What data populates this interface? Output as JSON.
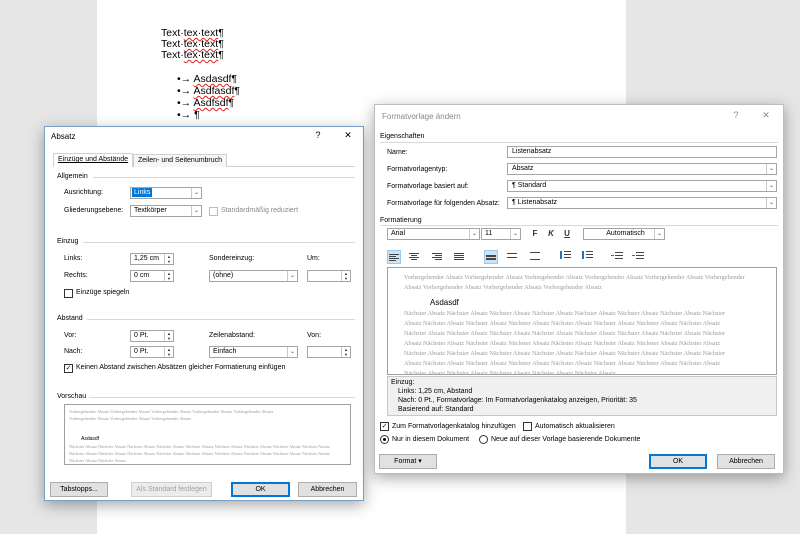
{
  "document": {
    "lines": [
      "Text·tex·text¶",
      "Text·tex·text¶",
      "Text·tex·text¶"
    ],
    "bullets": [
      "•→ Asdasdf¶",
      "•→ Asdfasdf¶",
      "•→ Asdfsdf¶",
      "•→ ¶"
    ]
  },
  "absatz": {
    "title": "Absatz",
    "help": "?",
    "close": "✕",
    "tabs": [
      "Einzüge und Abstände",
      "Zeilen- und Seitenumbruch"
    ],
    "allgemein": {
      "header": "Allgemein",
      "ausrichtung_label": "Ausrichtung:",
      "ausrichtung_value": "Links",
      "gliederung_label": "Gliederungsebene:",
      "gliederung_value": "Textkörper",
      "standard_reduziert": "Standardmäßig reduziert"
    },
    "einzug": {
      "header": "Einzug",
      "links_label": "Links:",
      "links_value": "1,25 cm",
      "rechts_label": "Rechts:",
      "rechts_value": "0 cm",
      "sondereinzug_label": "Sondereinzug:",
      "sondereinzug_value": "(ohne)",
      "um_label": "Um:",
      "spiegeln_label": "Einzüge spiegeln"
    },
    "abstand": {
      "header": "Abstand",
      "vor_label": "Vor:",
      "vor_value": "0 Pt.",
      "nach_label": "Nach:",
      "nach_value": "0 Pt.",
      "zeilenabstand_label": "Zeilenabstand:",
      "zeilenabstand_value": "Einfach",
      "von_label": "Von:",
      "kein_abstand_label": "Keinen Abstand zwischen Absätzen gleicher Formatierung einfügen"
    },
    "vorschau": {
      "header": "Vorschau",
      "prev": "Vorhergehender Absatz Vorhergehender Absatz Vorhergehender Absatz Vorhergehender Absatz Vorhergehender Absatz Vorhergehender Absatz Vorhergehender Absatz Vorhergehender Absatz",
      "sample": "Asdasdf",
      "next": "Nächster Absatz Nächster Absatz Nächster Absatz Nächster Absatz Nächster Absatz Nächster Absatz Nächster Absatz Nächster Absatz Nächster Absatz Nächster Absatz Nächster Absatz Nächster Absatz Nächster Absatz Nächster Absatz Nächster Absatz Nächster Absatz Nächster Absatz Nächster Absatz Nächster Absatz Nächster Absatz"
    },
    "buttons": {
      "tabstopps": "Tabstopps...",
      "als_standard": "Als Standard festlegen",
      "ok": "OK",
      "abbrechen": "Abbrechen"
    }
  },
  "formatvorlage": {
    "title": "Formatvorlage ändern",
    "help": "?",
    "close": "✕",
    "eigenschaften": {
      "header": "Eigenschaften",
      "name_label": "Name:",
      "name_value": "Listenabsatz",
      "typ_label": "Formatvorlagentyp:",
      "typ_value": "Absatz",
      "basiert_label": "Formatvorlage basiert auf:",
      "basiert_value": "¶  Standard",
      "folgend_label": "Formatvorlage für folgenden Absatz:",
      "folgend_value": "¶  Listenabsatz"
    },
    "formatierung": {
      "header": "Formatierung",
      "font": "Arial",
      "size": "11",
      "bold": "F",
      "italic": "K",
      "underline": "U",
      "color": "Automatisch"
    },
    "preview": {
      "prev": "Vorhergehender Absatz Vorhergehender Absatz Vorhergehender Absatz Vorhergehender Absatz Vorhergehender Absatz Vorhergehender Absatz Vorhergehender Absatz Vorhergehender Absatz Vorhergehender Absatz",
      "sample": "Asdasdf",
      "next": "Nächster Absatz Nächster Absatz Nächster Absatz Nächster Absatz Nächster Absatz Nächster Absatz Nächster Absatz Nächster Absatz Nächster Absatz Nächster Absatz Nächster Absatz Nächster Absatz Nächster Absatz Nächster Absatz Nächster Absatz Nächster Absatz Nächster Absatz Nächster Absatz Nächster Absatz Nächster Absatz Nächster Absatz Nächster Absatz Nächster Absatz Nächster Absatz Nächster Absatz Nächster Absatz Nächster Absatz Nächster Absatz Nächster Absatz Nächster Absatz Nächster Absatz Nächster Absatz Nächster Absatz Nächster Absatz Nächster Absatz Nächster Absatz Nächster Absatz Nächster Absatz Nächster Absatz Nächster Absatz Nächster Absatz Nächster Absatz Nächster Absatz Nächster Absatz Nächster Absatz Nächster Absatz Nächster Absatz Nächster Absatz Nächster Absatz Nächster Absatz"
    },
    "description": {
      "line1": "Einzug:",
      "line2": "Links:  1,25 cm, Abstand",
      "line3": "Nach:  0 Pt., Formatvorlage: Im Formatvorlagenkatalog anzeigen, Priorität: 35",
      "line4": "Basierend auf: Standard"
    },
    "options": {
      "katalog_label": "Zum Formatvorlagenkatalog hinzufügen",
      "auto_label": "Automatisch aktualisieren",
      "nur_dokument_label": "Nur in diesem Dokument",
      "neue_vorlage_label": "Neue auf dieser Vorlage basierende Dokumente"
    },
    "buttons": {
      "format": "Format",
      "ok": "OK",
      "abbrechen": "Abbrechen"
    }
  }
}
